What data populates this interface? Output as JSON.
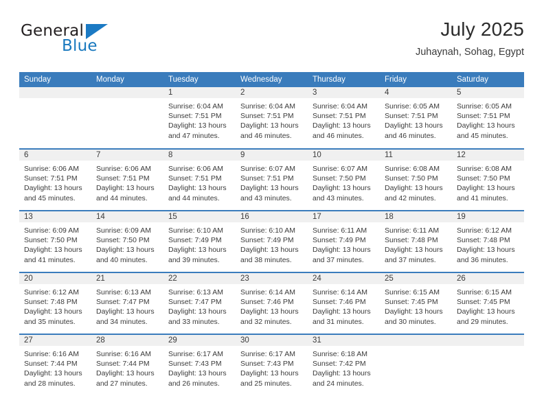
{
  "brand": {
    "name_top": "General",
    "name_bottom": "Blue",
    "triangle_color": "#1b7ac4",
    "text_color": "#231f20",
    "blue_text_color": "#1878be",
    "logo_icon": "triangle-icon"
  },
  "header": {
    "title": "July 2025",
    "subtitle": "Juhaynah, Sohag, Egypt"
  },
  "theme": {
    "header_bg": "#3a7cbc",
    "header_text": "#ffffff",
    "daynum_band_bg": "#f0f0f0",
    "cell_bg": "#ffffff",
    "body_text": "#3a3a3a",
    "separator": "#3a7cbc"
  },
  "calendar": {
    "columns": [
      "Sunday",
      "Monday",
      "Tuesday",
      "Wednesday",
      "Thursday",
      "Friday",
      "Saturday"
    ],
    "weeks": [
      [
        {
          "day": "",
          "empty": true,
          "sunrise": "",
          "sunset": "",
          "daylight_line1": "",
          "daylight_line2": ""
        },
        {
          "day": "",
          "empty": true,
          "sunrise": "",
          "sunset": "",
          "daylight_line1": "",
          "daylight_line2": ""
        },
        {
          "day": "1",
          "empty": false,
          "sunrise": "Sunrise: 6:04 AM",
          "sunset": "Sunset: 7:51 PM",
          "daylight_line1": "Daylight: 13 hours",
          "daylight_line2": "and 47 minutes."
        },
        {
          "day": "2",
          "empty": false,
          "sunrise": "Sunrise: 6:04 AM",
          "sunset": "Sunset: 7:51 PM",
          "daylight_line1": "Daylight: 13 hours",
          "daylight_line2": "and 46 minutes."
        },
        {
          "day": "3",
          "empty": false,
          "sunrise": "Sunrise: 6:04 AM",
          "sunset": "Sunset: 7:51 PM",
          "daylight_line1": "Daylight: 13 hours",
          "daylight_line2": "and 46 minutes."
        },
        {
          "day": "4",
          "empty": false,
          "sunrise": "Sunrise: 6:05 AM",
          "sunset": "Sunset: 7:51 PM",
          "daylight_line1": "Daylight: 13 hours",
          "daylight_line2": "and 46 minutes."
        },
        {
          "day": "5",
          "empty": false,
          "sunrise": "Sunrise: 6:05 AM",
          "sunset": "Sunset: 7:51 PM",
          "daylight_line1": "Daylight: 13 hours",
          "daylight_line2": "and 45 minutes."
        }
      ],
      [
        {
          "day": "6",
          "empty": false,
          "sunrise": "Sunrise: 6:06 AM",
          "sunset": "Sunset: 7:51 PM",
          "daylight_line1": "Daylight: 13 hours",
          "daylight_line2": "and 45 minutes."
        },
        {
          "day": "7",
          "empty": false,
          "sunrise": "Sunrise: 6:06 AM",
          "sunset": "Sunset: 7:51 PM",
          "daylight_line1": "Daylight: 13 hours",
          "daylight_line2": "and 44 minutes."
        },
        {
          "day": "8",
          "empty": false,
          "sunrise": "Sunrise: 6:06 AM",
          "sunset": "Sunset: 7:51 PM",
          "daylight_line1": "Daylight: 13 hours",
          "daylight_line2": "and 44 minutes."
        },
        {
          "day": "9",
          "empty": false,
          "sunrise": "Sunrise: 6:07 AM",
          "sunset": "Sunset: 7:51 PM",
          "daylight_line1": "Daylight: 13 hours",
          "daylight_line2": "and 43 minutes."
        },
        {
          "day": "10",
          "empty": false,
          "sunrise": "Sunrise: 6:07 AM",
          "sunset": "Sunset: 7:50 PM",
          "daylight_line1": "Daylight: 13 hours",
          "daylight_line2": "and 43 minutes."
        },
        {
          "day": "11",
          "empty": false,
          "sunrise": "Sunrise: 6:08 AM",
          "sunset": "Sunset: 7:50 PM",
          "daylight_line1": "Daylight: 13 hours",
          "daylight_line2": "and 42 minutes."
        },
        {
          "day": "12",
          "empty": false,
          "sunrise": "Sunrise: 6:08 AM",
          "sunset": "Sunset: 7:50 PM",
          "daylight_line1": "Daylight: 13 hours",
          "daylight_line2": "and 41 minutes."
        }
      ],
      [
        {
          "day": "13",
          "empty": false,
          "sunrise": "Sunrise: 6:09 AM",
          "sunset": "Sunset: 7:50 PM",
          "daylight_line1": "Daylight: 13 hours",
          "daylight_line2": "and 41 minutes."
        },
        {
          "day": "14",
          "empty": false,
          "sunrise": "Sunrise: 6:09 AM",
          "sunset": "Sunset: 7:50 PM",
          "daylight_line1": "Daylight: 13 hours",
          "daylight_line2": "and 40 minutes."
        },
        {
          "day": "15",
          "empty": false,
          "sunrise": "Sunrise: 6:10 AM",
          "sunset": "Sunset: 7:49 PM",
          "daylight_line1": "Daylight: 13 hours",
          "daylight_line2": "and 39 minutes."
        },
        {
          "day": "16",
          "empty": false,
          "sunrise": "Sunrise: 6:10 AM",
          "sunset": "Sunset: 7:49 PM",
          "daylight_line1": "Daylight: 13 hours",
          "daylight_line2": "and 38 minutes."
        },
        {
          "day": "17",
          "empty": false,
          "sunrise": "Sunrise: 6:11 AM",
          "sunset": "Sunset: 7:49 PM",
          "daylight_line1": "Daylight: 13 hours",
          "daylight_line2": "and 37 minutes."
        },
        {
          "day": "18",
          "empty": false,
          "sunrise": "Sunrise: 6:11 AM",
          "sunset": "Sunset: 7:48 PM",
          "daylight_line1": "Daylight: 13 hours",
          "daylight_line2": "and 37 minutes."
        },
        {
          "day": "19",
          "empty": false,
          "sunrise": "Sunrise: 6:12 AM",
          "sunset": "Sunset: 7:48 PM",
          "daylight_line1": "Daylight: 13 hours",
          "daylight_line2": "and 36 minutes."
        }
      ],
      [
        {
          "day": "20",
          "empty": false,
          "sunrise": "Sunrise: 6:12 AM",
          "sunset": "Sunset: 7:48 PM",
          "daylight_line1": "Daylight: 13 hours",
          "daylight_line2": "and 35 minutes."
        },
        {
          "day": "21",
          "empty": false,
          "sunrise": "Sunrise: 6:13 AM",
          "sunset": "Sunset: 7:47 PM",
          "daylight_line1": "Daylight: 13 hours",
          "daylight_line2": "and 34 minutes."
        },
        {
          "day": "22",
          "empty": false,
          "sunrise": "Sunrise: 6:13 AM",
          "sunset": "Sunset: 7:47 PM",
          "daylight_line1": "Daylight: 13 hours",
          "daylight_line2": "and 33 minutes."
        },
        {
          "day": "23",
          "empty": false,
          "sunrise": "Sunrise: 6:14 AM",
          "sunset": "Sunset: 7:46 PM",
          "daylight_line1": "Daylight: 13 hours",
          "daylight_line2": "and 32 minutes."
        },
        {
          "day": "24",
          "empty": false,
          "sunrise": "Sunrise: 6:14 AM",
          "sunset": "Sunset: 7:46 PM",
          "daylight_line1": "Daylight: 13 hours",
          "daylight_line2": "and 31 minutes."
        },
        {
          "day": "25",
          "empty": false,
          "sunrise": "Sunrise: 6:15 AM",
          "sunset": "Sunset: 7:45 PM",
          "daylight_line1": "Daylight: 13 hours",
          "daylight_line2": "and 30 minutes."
        },
        {
          "day": "26",
          "empty": false,
          "sunrise": "Sunrise: 6:15 AM",
          "sunset": "Sunset: 7:45 PM",
          "daylight_line1": "Daylight: 13 hours",
          "daylight_line2": "and 29 minutes."
        }
      ],
      [
        {
          "day": "27",
          "empty": false,
          "sunrise": "Sunrise: 6:16 AM",
          "sunset": "Sunset: 7:44 PM",
          "daylight_line1": "Daylight: 13 hours",
          "daylight_line2": "and 28 minutes."
        },
        {
          "day": "28",
          "empty": false,
          "sunrise": "Sunrise: 6:16 AM",
          "sunset": "Sunset: 7:44 PM",
          "daylight_line1": "Daylight: 13 hours",
          "daylight_line2": "and 27 minutes."
        },
        {
          "day": "29",
          "empty": false,
          "sunrise": "Sunrise: 6:17 AM",
          "sunset": "Sunset: 7:43 PM",
          "daylight_line1": "Daylight: 13 hours",
          "daylight_line2": "and 26 minutes."
        },
        {
          "day": "30",
          "empty": false,
          "sunrise": "Sunrise: 6:17 AM",
          "sunset": "Sunset: 7:43 PM",
          "daylight_line1": "Daylight: 13 hours",
          "daylight_line2": "and 25 minutes."
        },
        {
          "day": "31",
          "empty": false,
          "sunrise": "Sunrise: 6:18 AM",
          "sunset": "Sunset: 7:42 PM",
          "daylight_line1": "Daylight: 13 hours",
          "daylight_line2": "and 24 minutes."
        },
        {
          "day": "",
          "empty": true,
          "sunrise": "",
          "sunset": "",
          "daylight_line1": "",
          "daylight_line2": ""
        },
        {
          "day": "",
          "empty": true,
          "sunrise": "",
          "sunset": "",
          "daylight_line1": "",
          "daylight_line2": ""
        }
      ]
    ]
  }
}
